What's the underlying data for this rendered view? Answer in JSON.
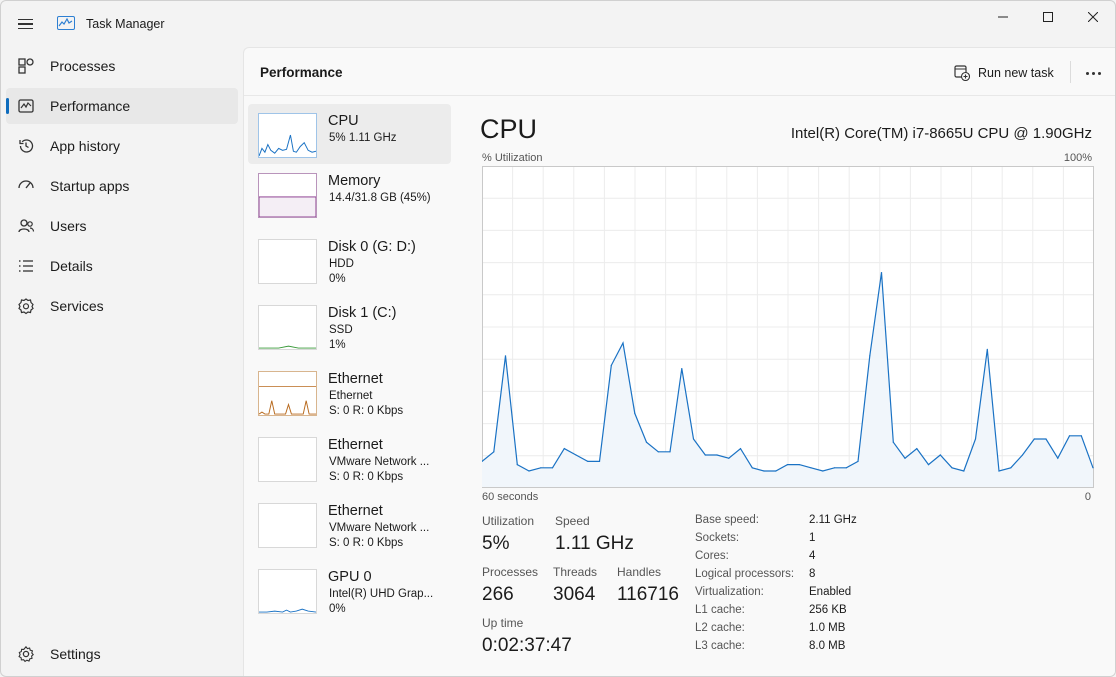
{
  "app": {
    "title": "Task Manager"
  },
  "sidebar": {
    "items": [
      {
        "label": "Processes",
        "icon": "processes-icon"
      },
      {
        "label": "Performance",
        "icon": "performance-icon",
        "active": true
      },
      {
        "label": "App history",
        "icon": "history-icon"
      },
      {
        "label": "Startup apps",
        "icon": "startup-icon"
      },
      {
        "label": "Users",
        "icon": "users-icon"
      },
      {
        "label": "Details",
        "icon": "details-icon"
      },
      {
        "label": "Services",
        "icon": "services-icon"
      }
    ],
    "settings_label": "Settings"
  },
  "header": {
    "title": "Performance",
    "run_task_label": "Run new task"
  },
  "resources": [
    {
      "name": "CPU",
      "lines": [
        "5% 1.11 GHz"
      ],
      "color": "#1a72c4"
    },
    {
      "name": "Memory",
      "lines": [
        "14.4/31.8 GB (45%)"
      ],
      "color": "#8b3a8f"
    },
    {
      "name": "Disk 0 (G: D:)",
      "lines": [
        "HDD",
        "0%"
      ],
      "color": "#3a9a3a"
    },
    {
      "name": "Disk 1 (C:)",
      "lines": [
        "SSD",
        "1%"
      ],
      "color": "#3a9a3a"
    },
    {
      "name": "Ethernet",
      "lines": [
        "Ethernet",
        "S: 0 R: 0 Kbps"
      ],
      "color": "#b86a1e"
    },
    {
      "name": "Ethernet",
      "lines": [
        "VMware Network ...",
        "S: 0 R: 0 Kbps"
      ],
      "color": "#b86a1e"
    },
    {
      "name": "Ethernet",
      "lines": [
        "VMware Network ...",
        "S: 0 R: 0 Kbps"
      ],
      "color": "#b86a1e"
    },
    {
      "name": "GPU 0",
      "lines": [
        "Intel(R) UHD Grap...",
        "0%"
      ],
      "color": "#1a72c4"
    }
  ],
  "detail": {
    "title": "CPU",
    "model": "Intel(R) Core(TM) i7-8665U CPU @ 1.90GHz",
    "util_label": "% Utilization",
    "util_max": "100%",
    "axis_left": "60 seconds",
    "axis_right": "0",
    "stats": {
      "utilization_label": "Utilization",
      "utilization": "5%",
      "speed_label": "Speed",
      "speed": "1.11 GHz",
      "processes_label": "Processes",
      "processes": "266",
      "threads_label": "Threads",
      "threads": "3064",
      "handles_label": "Handles",
      "handles": "116716",
      "uptime_label": "Up time",
      "uptime": "0:02:37:47"
    },
    "specs": [
      {
        "label": "Base speed:",
        "value": "2.11 GHz"
      },
      {
        "label": "Sockets:",
        "value": "1"
      },
      {
        "label": "Cores:",
        "value": "4"
      },
      {
        "label": "Logical processors:",
        "value": "8"
      },
      {
        "label": "Virtualization:",
        "value": "Enabled"
      },
      {
        "label": "L1 cache:",
        "value": "256 KB"
      },
      {
        "label": "L2 cache:",
        "value": "1.0 MB"
      },
      {
        "label": "L3 cache:",
        "value": "8.0 MB"
      }
    ]
  },
  "chart_data": {
    "type": "area",
    "y_range": [
      0,
      100
    ],
    "x_range": [
      60,
      0
    ],
    "grid": true,
    "series": [
      {
        "values": [
          8,
          11,
          41,
          7,
          5,
          6,
          6,
          12,
          10,
          8,
          8,
          38,
          45,
          23,
          14,
          11,
          11,
          37,
          15,
          10,
          10,
          9,
          12,
          6,
          5,
          5,
          7,
          7,
          6,
          5,
          6,
          6,
          8,
          41,
          67,
          14,
          9,
          12,
          7,
          10,
          6,
          5,
          15,
          43,
          5,
          6,
          10,
          15,
          15,
          9,
          16,
          16,
          6
        ]
      }
    ]
  },
  "colors": {
    "accent": "#0f6cbd",
    "cpu_line": "#1a72c4",
    "cpu_fill": "#f1f6fb"
  }
}
